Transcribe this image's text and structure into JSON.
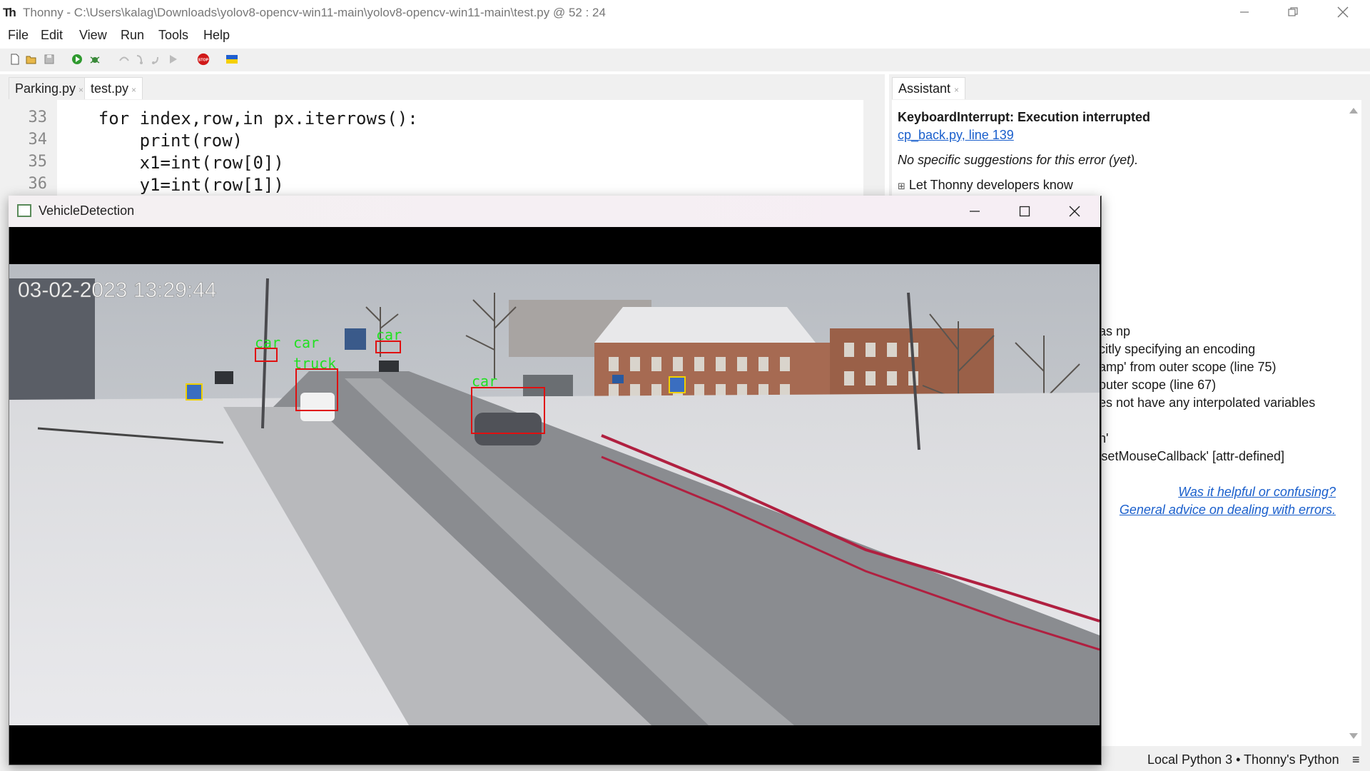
{
  "window": {
    "app_title": "Thonny  -  C:\\Users\\kalag\\Downloads\\yolov8-opencv-win11-main\\yolov8-opencv-win11-main\\test.py  @  52 : 24",
    "app_icon_text": "Th"
  },
  "menu": [
    "File",
    "Edit",
    "View",
    "Run",
    "Tools",
    "Help"
  ],
  "toolbar": {
    "icons": [
      "new-file-icon",
      "open-file-icon",
      "save-icon",
      "run-icon",
      "debug-icon",
      "step-over-icon",
      "step-into-icon",
      "step-out-icon",
      "resume-icon",
      "stop-icon",
      "ukraine-flag-icon"
    ],
    "stop_text": "STOP"
  },
  "editor": {
    "tabs": [
      {
        "label": "Parking.py",
        "close": "×"
      },
      {
        "label": "test.py",
        "close": "×"
      }
    ],
    "lines": [
      {
        "no": "33",
        "text": "    for index,row,in px.iterrows():"
      },
      {
        "no": "34",
        "text": "        print(row)"
      },
      {
        "no": "35",
        "text": "        x1=int(row[0])"
      },
      {
        "no": "36",
        "text": "        y1=int(row[1])"
      }
    ]
  },
  "assistant": {
    "tab_label": "Assistant",
    "tab_close": "×",
    "error_title": "KeyboardInterrupt: Execution interrupted",
    "error_link": "cp_back.py, line 139",
    "no_suggestions": "No specific suggestions for this error (yet).",
    "expand_symbol": "⊞",
    "let_know": "Let Thonny developers know",
    "warnings": [
      "as np",
      "citly specifying an encoding",
      "amp' from outer scope (line 75)",
      "outer scope (line 67)",
      "es not have any interpolated variables",
      "n'",
      "'setMouseCallback'  [attr-defined]"
    ],
    "helpful_link": "Was it helpful or confusing?",
    "advice_link": "General advice on dealing with errors."
  },
  "status": {
    "interpreter": "Local Python 3  •  Thonny's Python",
    "menu_icon": "≡"
  },
  "vehicle_window": {
    "title": "VehicleDetection",
    "timestamp": "03-02-2023 13:29:44",
    "detections": [
      "car",
      "car",
      "car",
      "truck",
      "car"
    ],
    "box_color": "#e01010",
    "label_color": "#22e022"
  }
}
